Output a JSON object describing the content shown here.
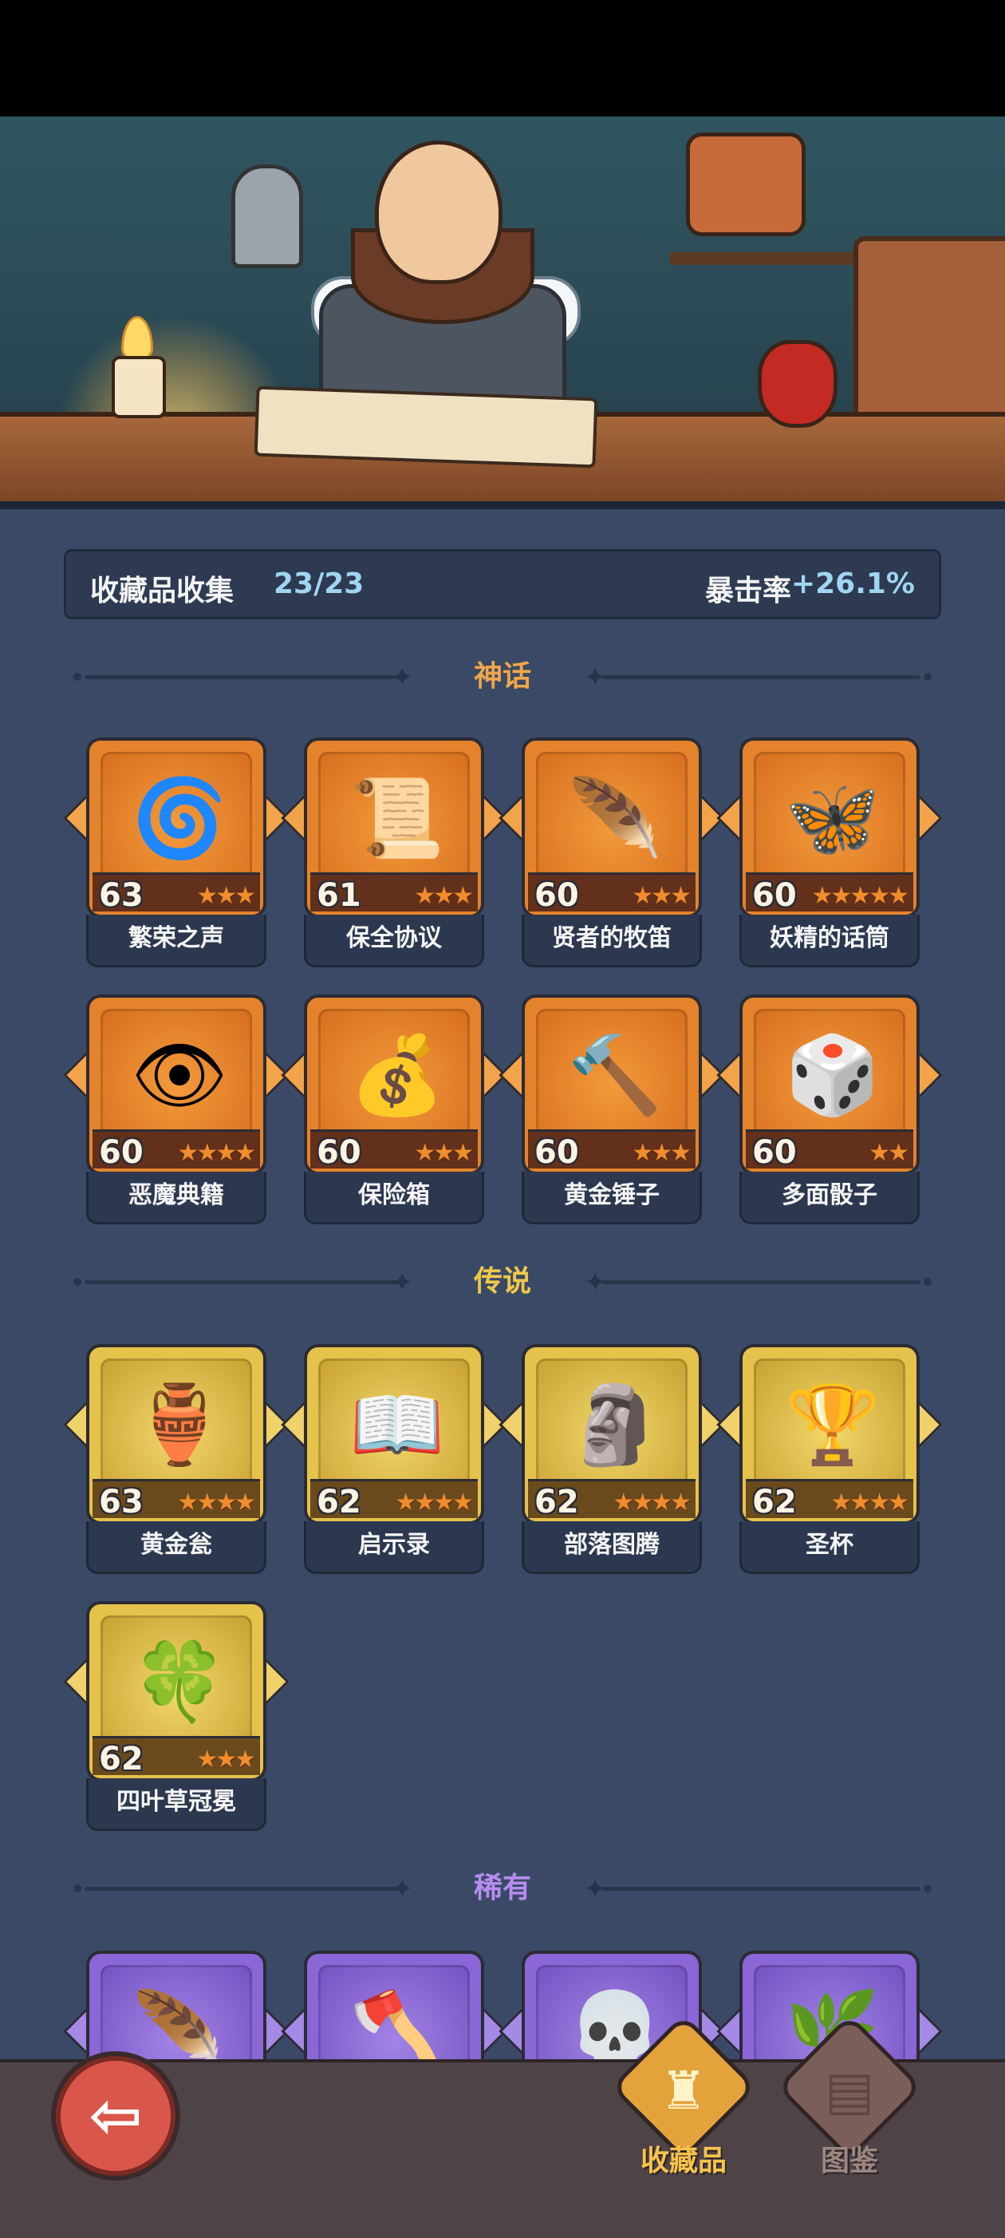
{
  "header": {
    "title": "收藏品收集",
    "count": "23/23",
    "crit_label": "暴击率",
    "crit_value": "+26.1%"
  },
  "sections": {
    "myth": {
      "label": "神话",
      "color": "#f0a64a"
    },
    "legend": {
      "label": "传说",
      "color": "#f0c84a"
    },
    "rare": {
      "label": "稀有",
      "color": "#b78cf2"
    }
  },
  "myth_items": [
    {
      "name": "繁荣之声",
      "level": "63",
      "stars": 3,
      "icon": "spirit-icon",
      "glyph": "🌀"
    },
    {
      "name": "保全协议",
      "level": "61",
      "stars": 3,
      "icon": "scroll-document-icon",
      "glyph": "📜"
    },
    {
      "name": "贤者的牧笛",
      "level": "60",
      "stars": 3,
      "icon": "flute-icon",
      "glyph": "🪶"
    },
    {
      "name": "妖精的话筒",
      "level": "60",
      "stars": 5,
      "icon": "fairy-microphone-icon",
      "glyph": "🦋"
    },
    {
      "name": "恶魔典籍",
      "level": "60",
      "stars": 4,
      "icon": "demon-tome-icon",
      "glyph": "👁"
    },
    {
      "name": "保险箱",
      "level": "60",
      "stars": 3,
      "icon": "treasure-chest-icon",
      "glyph": "💰"
    },
    {
      "name": "黄金锤子",
      "level": "60",
      "stars": 3,
      "icon": "golden-hammer-icon",
      "glyph": "🔨"
    },
    {
      "name": "多面骰子",
      "level": "60",
      "stars": 2,
      "icon": "dice-icon",
      "glyph": "🎲"
    }
  ],
  "legend_items": [
    {
      "name": "黄金瓮",
      "level": "63",
      "stars": 4,
      "icon": "golden-urn-icon",
      "glyph": "🏺"
    },
    {
      "name": "启示录",
      "level": "62",
      "stars": 4,
      "icon": "open-book-icon",
      "glyph": "📖"
    },
    {
      "name": "部落图腾",
      "level": "62",
      "stars": 4,
      "icon": "tribal-totem-icon",
      "glyph": "🗿"
    },
    {
      "name": "圣杯",
      "level": "62",
      "stars": 4,
      "icon": "chalice-icon",
      "glyph": "🏆"
    },
    {
      "name": "四叶草冠冕",
      "level": "62",
      "stars": 3,
      "icon": "clover-crown-icon",
      "glyph": "🍀"
    }
  ],
  "rare_items": [
    {
      "icon": "phoenix-feather-icon",
      "glyph": "🪶"
    },
    {
      "icon": "axe-icon",
      "glyph": "🪓"
    },
    {
      "icon": "skull-totem-icon",
      "glyph": "💀"
    },
    {
      "icon": "thorn-vine-icon",
      "glyph": "🌿"
    }
  ],
  "nav": {
    "back_icon": "back-arrow-icon",
    "collect_label": "收藏品",
    "book_label": "图鉴"
  }
}
